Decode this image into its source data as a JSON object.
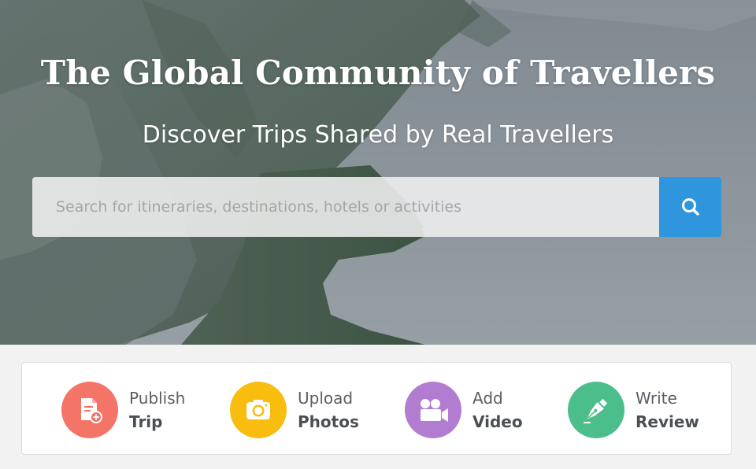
{
  "hero": {
    "title": "The Global Community of Travellers",
    "subtitle": "Discover Trips Shared by Real Travellers"
  },
  "search": {
    "placeholder": "Search for itineraries, destinations, hotels or activities",
    "value": "",
    "button_icon": "search-icon",
    "button_color": "#2f95dd"
  },
  "actions": [
    {
      "line1": "Publish",
      "line2": "Trip",
      "icon": "document-add-icon",
      "color": "#f47468"
    },
    {
      "line1": "Upload",
      "line2": "Photos",
      "icon": "camera-icon",
      "color": "#f9bd0f"
    },
    {
      "line1": "Add",
      "line2": "Video",
      "icon": "video-camera-icon",
      "color": "#b27dd0"
    },
    {
      "line1": "Write",
      "line2": "Review",
      "icon": "fountain-pen-icon",
      "color": "#4cbe8c"
    }
  ]
}
